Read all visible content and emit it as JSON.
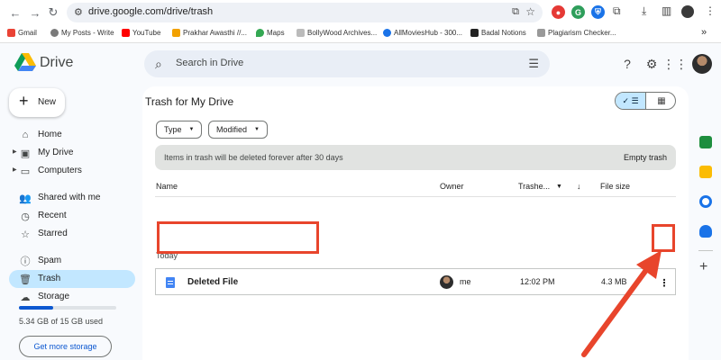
{
  "browser": {
    "url": "drive.google.com/drive/trash",
    "bookmarks": [
      {
        "label": "Gmail",
        "color": "#ea4335"
      },
      {
        "label": "My Posts - Write",
        "color": "#7a7a7a"
      },
      {
        "label": "YouTube",
        "color": "#ff0000"
      },
      {
        "label": "Prakhar Awasthi //...",
        "color": "#f2a100"
      },
      {
        "label": "Maps",
        "color": "#34a853"
      },
      {
        "label": "BollyWood Archives...",
        "color": "#bbbbbb"
      },
      {
        "label": "AllMoviesHub - 300...",
        "color": "#1a73e8"
      },
      {
        "label": "Badal Notions",
        "color": "#222222"
      },
      {
        "label": "Plagiarism Checker...",
        "color": "#999999"
      }
    ],
    "more_bookmarks": "»"
  },
  "drive": {
    "brand": "Drive",
    "search_placeholder": "Search in Drive",
    "new_label": "New",
    "sidebar": [
      {
        "label": "Home",
        "icon": "home-icon",
        "glyph": "⌂"
      },
      {
        "label": "My Drive",
        "icon": "my-drive-icon",
        "glyph": "▣"
      },
      {
        "label": "Computers",
        "icon": "computers-icon",
        "glyph": "▭"
      },
      {
        "label": "Shared with me",
        "icon": "shared-icon",
        "glyph": "👥"
      },
      {
        "label": "Recent",
        "icon": "recent-icon",
        "glyph": "◷"
      },
      {
        "label": "Starred",
        "icon": "star-icon",
        "glyph": "☆"
      },
      {
        "label": "Spam",
        "icon": "spam-icon",
        "glyph": "ⓘ"
      },
      {
        "label": "Trash",
        "icon": "trash-icon",
        "glyph": "🗑"
      },
      {
        "label": "Storage",
        "icon": "cloud-icon",
        "glyph": "☁"
      }
    ],
    "storage": {
      "text": "5.34 GB of 15 GB used",
      "fraction": 0.356,
      "button": "Get more storage"
    },
    "page_title": "Trash for My Drive",
    "filters": [
      {
        "label": "Type"
      },
      {
        "label": "Modified"
      }
    ],
    "banner": {
      "text": "Items in trash will be deleted forever after 30 days",
      "action": "Empty trash"
    },
    "columns": {
      "name": "Name",
      "owner": "Owner",
      "trashed": "Trashe...",
      "size": "File size"
    },
    "group": "Today",
    "files": [
      {
        "name": "Deleted File",
        "owner": "me",
        "date": "12:02 PM",
        "size": "4.3 MB"
      }
    ]
  },
  "colors": {
    "accent": "#0b57d0",
    "active": "#c2e7ff",
    "annotation": "#e8452c"
  }
}
